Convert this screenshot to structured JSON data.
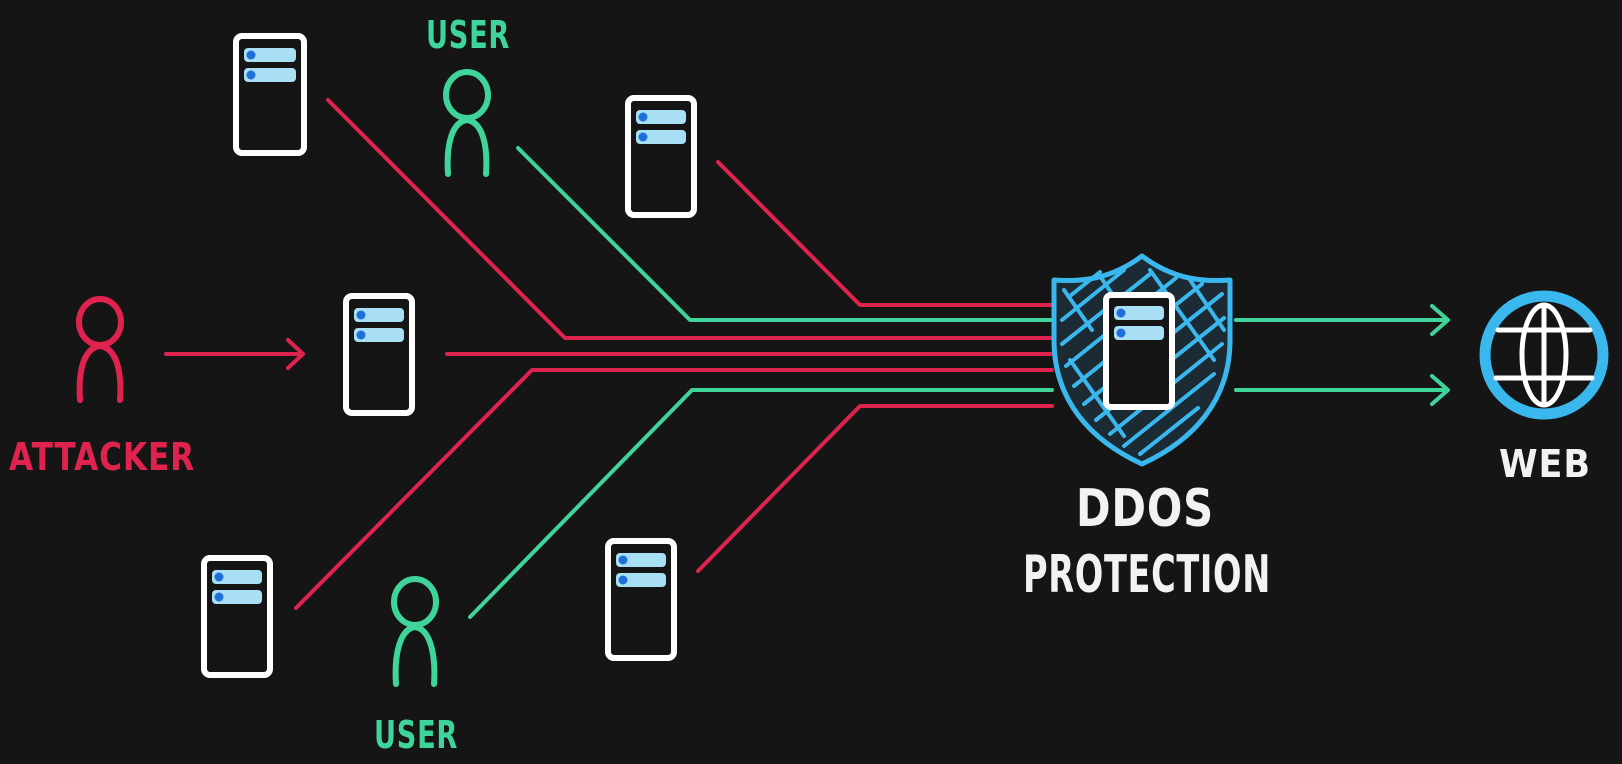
{
  "labels": {
    "user_top": "USER",
    "user_bottom": "USER",
    "attacker": "ATTACKER",
    "ddos_line1": "DDOS",
    "ddos_line2": "PROTECTION",
    "web": "WEB"
  },
  "colors": {
    "background": "#151515",
    "attack": "#e0234e",
    "legit": "#3fd49a",
    "shield": "#3ab8ee",
    "server_outline": "#ffffff",
    "server_slot": "#a9dff5",
    "server_dot": "#1f6fd8",
    "text_neutral": "#f2f2f2"
  },
  "icons": {
    "server": "server-icon",
    "person": "person-icon",
    "shield": "shield-icon",
    "globe": "globe-icon",
    "arrow": "arrow-right-icon"
  }
}
